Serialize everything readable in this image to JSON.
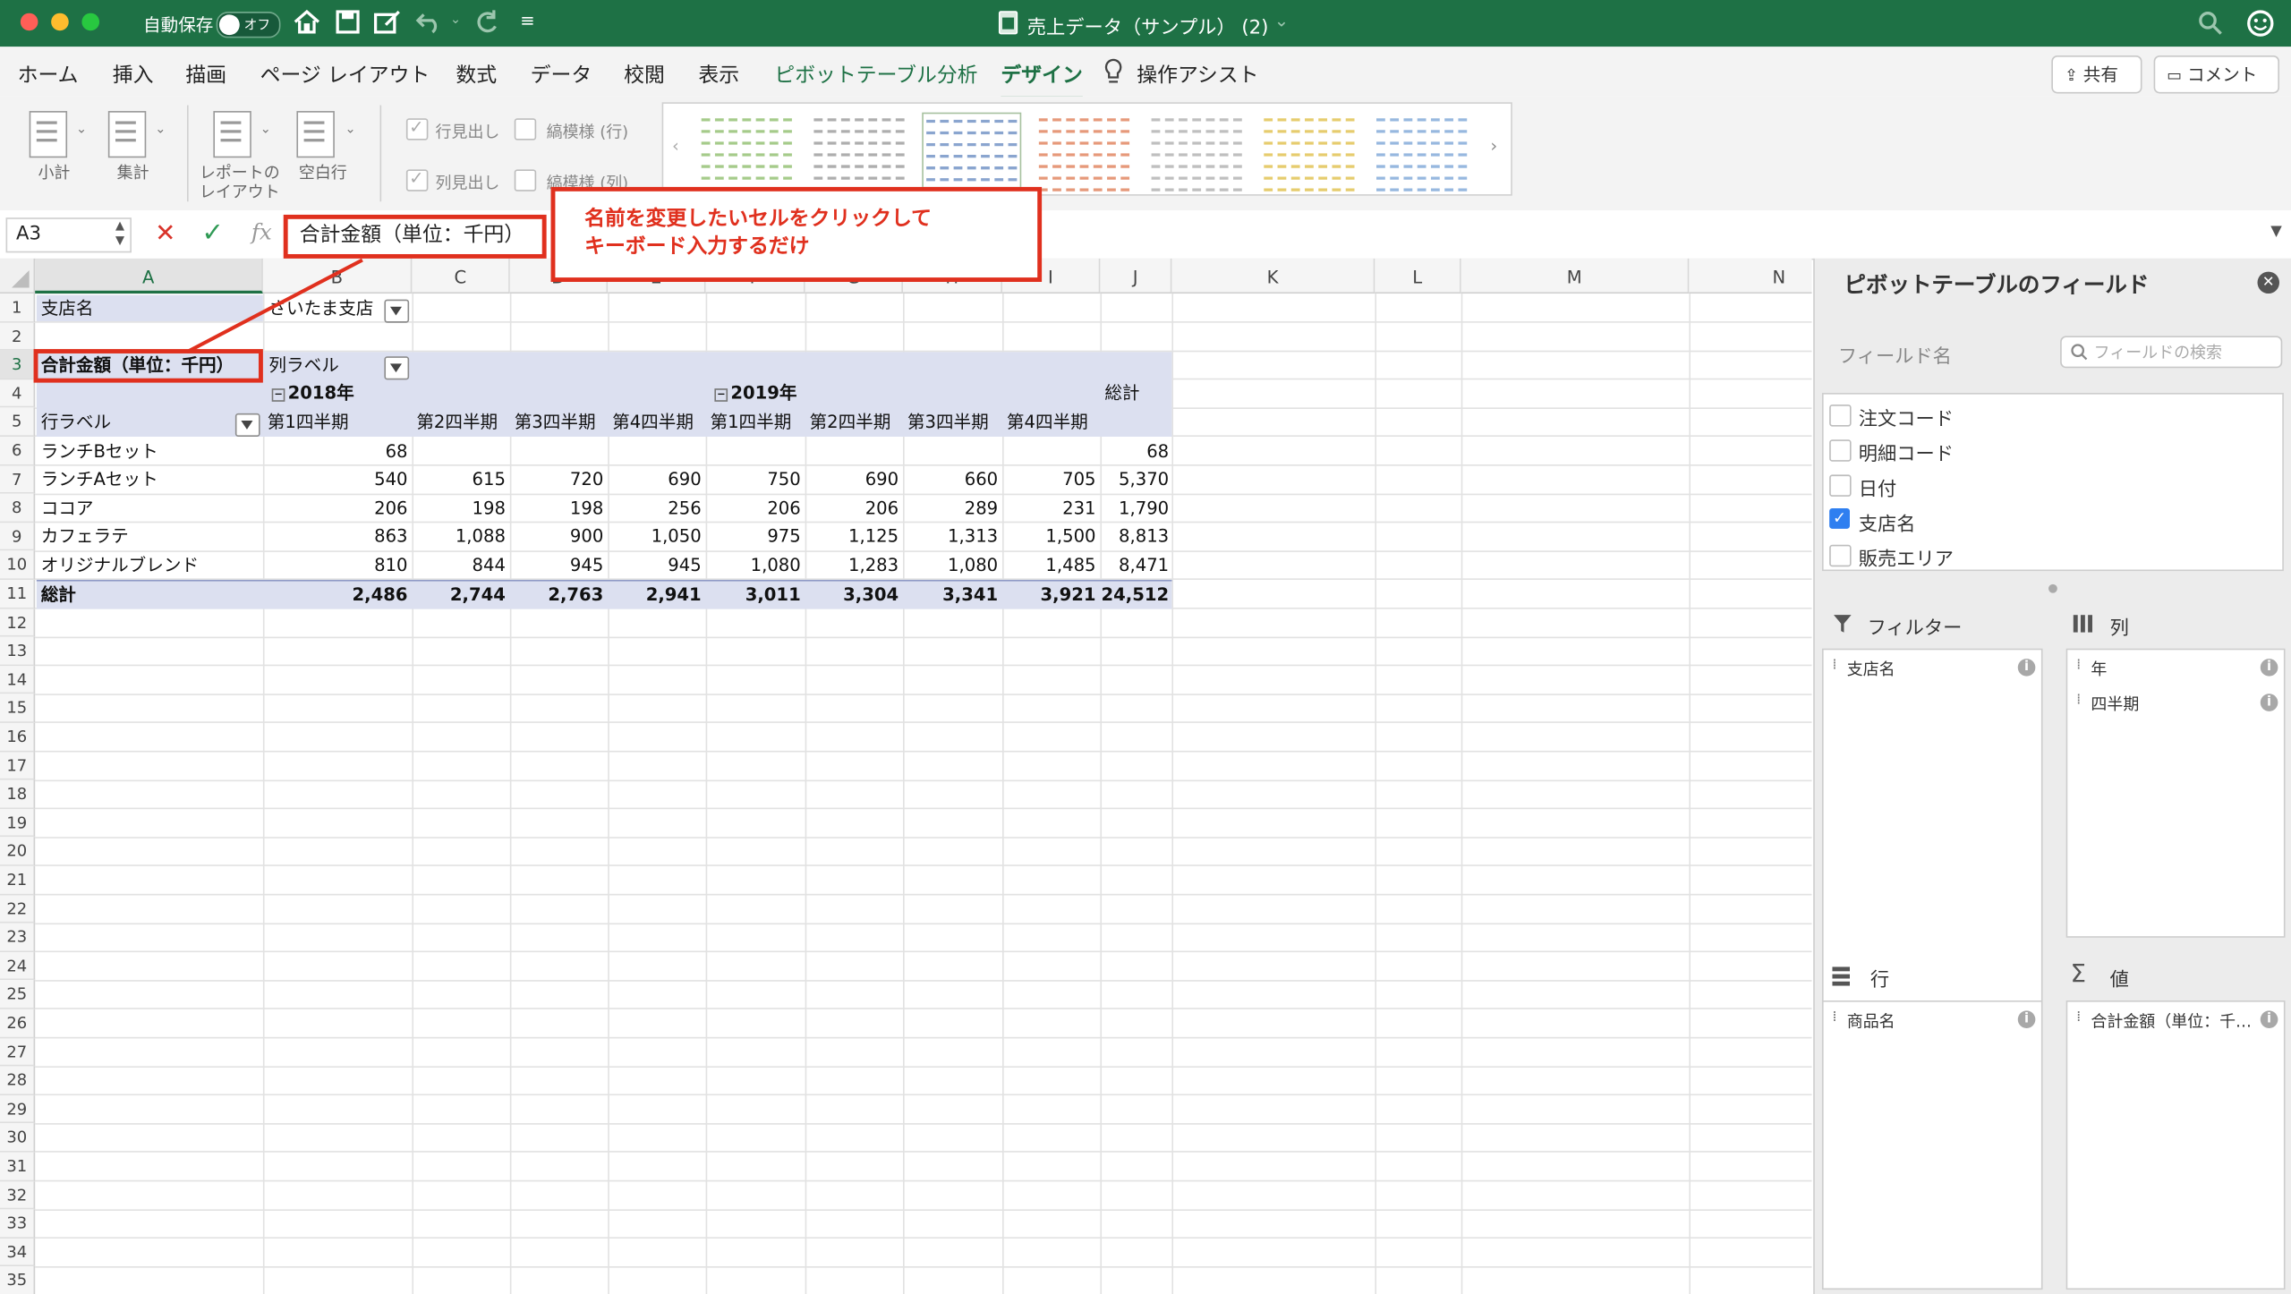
{
  "titlebar": {
    "autosave_label": "自動保存",
    "autosave_state": "オフ",
    "doc_title": "売上データ（サンプル） (2)",
    "title_caret": "⌄"
  },
  "ribbon_tabs": [
    "ホーム",
    "挿入",
    "描画",
    "ページ レイアウト",
    "数式",
    "データ",
    "校閲",
    "表示",
    "ピボットテーブル分析",
    "デザイン",
    "操作アシスト"
  ],
  "share_label": "共有",
  "comment_label": "コメント",
  "ribbon": {
    "subtotal": "小計",
    "grandtotal": "集計",
    "report_layout_1": "レポートの",
    "report_layout_2": "レイアウト",
    "blank_rows": "空白行",
    "row_headers": "行見出し",
    "col_headers": "列見出し",
    "banded_rows": "縞模様 (行)",
    "banded_cols": "縞模様 (列)"
  },
  "formula_bar": {
    "name_box": "A3",
    "fx": "fx",
    "cancel": "✕",
    "confirm": "✓",
    "content": "合計金額（単位：千円）"
  },
  "callout": {
    "line1": "名前を変更したいセルをクリックして",
    "line2": "キーボード入力するだけ"
  },
  "columns": [
    "A",
    "B",
    "C",
    "D",
    "E",
    "F",
    "G",
    "H",
    "I",
    "J",
    "K",
    "L",
    "M",
    "N"
  ],
  "rows": [
    "1",
    "2",
    "3",
    "4",
    "5",
    "6",
    "7",
    "8",
    "9",
    "10",
    "11",
    "12",
    "13",
    "14",
    "15",
    "16",
    "17",
    "18",
    "19",
    "20",
    "21",
    "22",
    "23",
    "24",
    "25",
    "26",
    "27",
    "28",
    "29",
    "30",
    "31",
    "32",
    "33",
    "34",
    "35"
  ],
  "pivot": {
    "filter_label": "支店名",
    "filter_value": "さいたま支店",
    "value_header": "合計金額（単位：千円）",
    "col_labels": "列ラベル",
    "row_labels": "行ラベル",
    "year_2018": "2018年",
    "year_2019": "2019年",
    "grand_total_col": "総計",
    "quarters": [
      "第1四半期",
      "第2四半期",
      "第3四半期",
      "第4四半期",
      "第1四半期",
      "第2四半期",
      "第3四半期",
      "第4四半期"
    ],
    "body": [
      {
        "name": "ランチBセット",
        "values": [
          "68",
          "",
          "",
          "",
          "",
          "",
          "",
          "",
          "68"
        ]
      },
      {
        "name": "ランチAセット",
        "values": [
          "540",
          "615",
          "720",
          "690",
          "750",
          "690",
          "660",
          "705",
          "5,370"
        ]
      },
      {
        "name": "ココア",
        "values": [
          "206",
          "198",
          "198",
          "256",
          "206",
          "206",
          "289",
          "231",
          "1,790"
        ]
      },
      {
        "name": "カフェラテ",
        "values": [
          "863",
          "1,088",
          "900",
          "1,050",
          "975",
          "1,125",
          "1,313",
          "1,500",
          "8,813"
        ]
      },
      {
        "name": "オリジナルブレンド",
        "values": [
          "810",
          "844",
          "945",
          "945",
          "1,080",
          "1,283",
          "1,080",
          "1,485",
          "8,471"
        ]
      }
    ],
    "total_row": {
      "name": "総計",
      "values": [
        "2,486",
        "2,744",
        "2,763",
        "2,941",
        "3,011",
        "3,304",
        "3,341",
        "3,921",
        "24,512"
      ]
    }
  },
  "field_pane": {
    "title": "ピボットテーブルのフィールド",
    "field_name_label": "フィールド名",
    "search_placeholder": "フィールドの検索",
    "fields": [
      {
        "label": "注文コード",
        "checked": false
      },
      {
        "label": "明細コード",
        "checked": false
      },
      {
        "label": "日付",
        "checked": false
      },
      {
        "label": "支店名",
        "checked": true
      },
      {
        "label": "販売エリア",
        "checked": false
      }
    ],
    "filters_title": "フィルター",
    "columns_title": "列",
    "rows_title": "行",
    "values_title": "値",
    "filters_items": [
      "支店名"
    ],
    "columns_items": [
      "年",
      "四半期"
    ],
    "rows_items": [
      "商品名"
    ],
    "values_items": [
      "合計金額（単位：千…"
    ]
  },
  "colors": {
    "excel_green": "#1e7145",
    "pivot_band": "#dce0f0",
    "annotation_red": "#e0301e"
  }
}
